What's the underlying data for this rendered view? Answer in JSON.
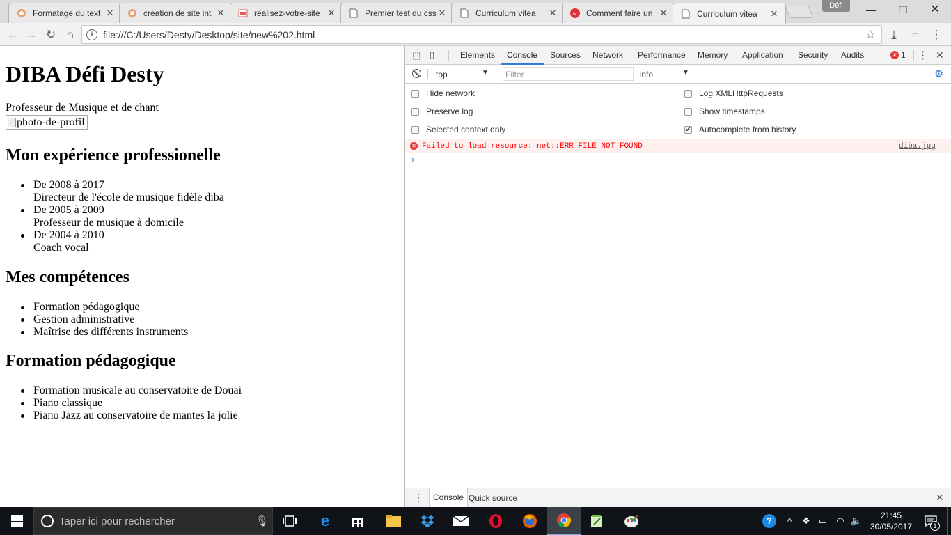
{
  "browser": {
    "tabs": [
      {
        "title": "Formatage du text",
        "icon": "oc-favicon"
      },
      {
        "title": "creation de site int",
        "icon": "oc-favicon"
      },
      {
        "title": "realisez-votre-site",
        "icon": "pdf-favicon"
      },
      {
        "title": "Premier test du css",
        "icon": "document-favicon"
      },
      {
        "title": "Curriculum vitea",
        "icon": "document-favicon"
      },
      {
        "title": "Comment faire un",
        "icon": "red-favicon"
      },
      {
        "title": "Curriculum vitea",
        "icon": "document-favicon"
      }
    ],
    "active_tab": 6,
    "profile_label": "Défi",
    "url": "file:///C:/Users/Desty/Desktop/site/new%202.html"
  },
  "page": {
    "title": "DIBA Défi Desty",
    "subtitle": "Professeur de Musique et de chant",
    "image_alt": "photo-de-profil",
    "experience": {
      "heading": "Mon expérience professionelle",
      "items": [
        {
          "period": "De 2008 à 2017",
          "role": "Directeur de l'école de musique fidèle diba"
        },
        {
          "period": "De 2005 à 2009",
          "role": "Professeur de musique à domicile"
        },
        {
          "period": "De 2004 à 2010",
          "role": "Coach vocal"
        }
      ]
    },
    "skills": {
      "heading": "Mes compétences",
      "items": [
        "Formation pédagogique",
        "Gestion administrative",
        "Maîtrise des différents instruments"
      ]
    },
    "training": {
      "heading": "Formation pédagogique",
      "items": [
        "Formation musicale au conservatoire de Douai",
        "Piano classique",
        "Piano Jazz au conservatoire de mantes la jolie"
      ]
    }
  },
  "devtools": {
    "tabs": [
      "Elements",
      "Console",
      "Sources",
      "Network",
      "Performance",
      "Memory",
      "Application",
      "Security",
      "Audits"
    ],
    "active_tab": "Console",
    "error_count": "1",
    "context": "top",
    "filter_placeholder": "Filter",
    "level": "Info",
    "settings": {
      "hide_network": "Hide network",
      "preserve_log": "Preserve log",
      "selected_context_only": "Selected context only",
      "log_xhr": "Log XMLHttpRequests",
      "show_timestamps": "Show timestamps",
      "autocomplete": "Autocomplete from history"
    },
    "error_message": "Failed to load resource: net::ERR_FILE_NOT_FOUND",
    "error_source": "diba.jpg",
    "drawer_tabs": [
      "Console",
      "Quick source"
    ]
  },
  "taskbar": {
    "search_placeholder": "Taper ici pour rechercher",
    "time": "21:45",
    "date": "30/05/2017",
    "notification_count": "1"
  },
  "colors": {
    "accent": "#3879d9",
    "error": "#ff0000",
    "taskbar": "#101418"
  }
}
